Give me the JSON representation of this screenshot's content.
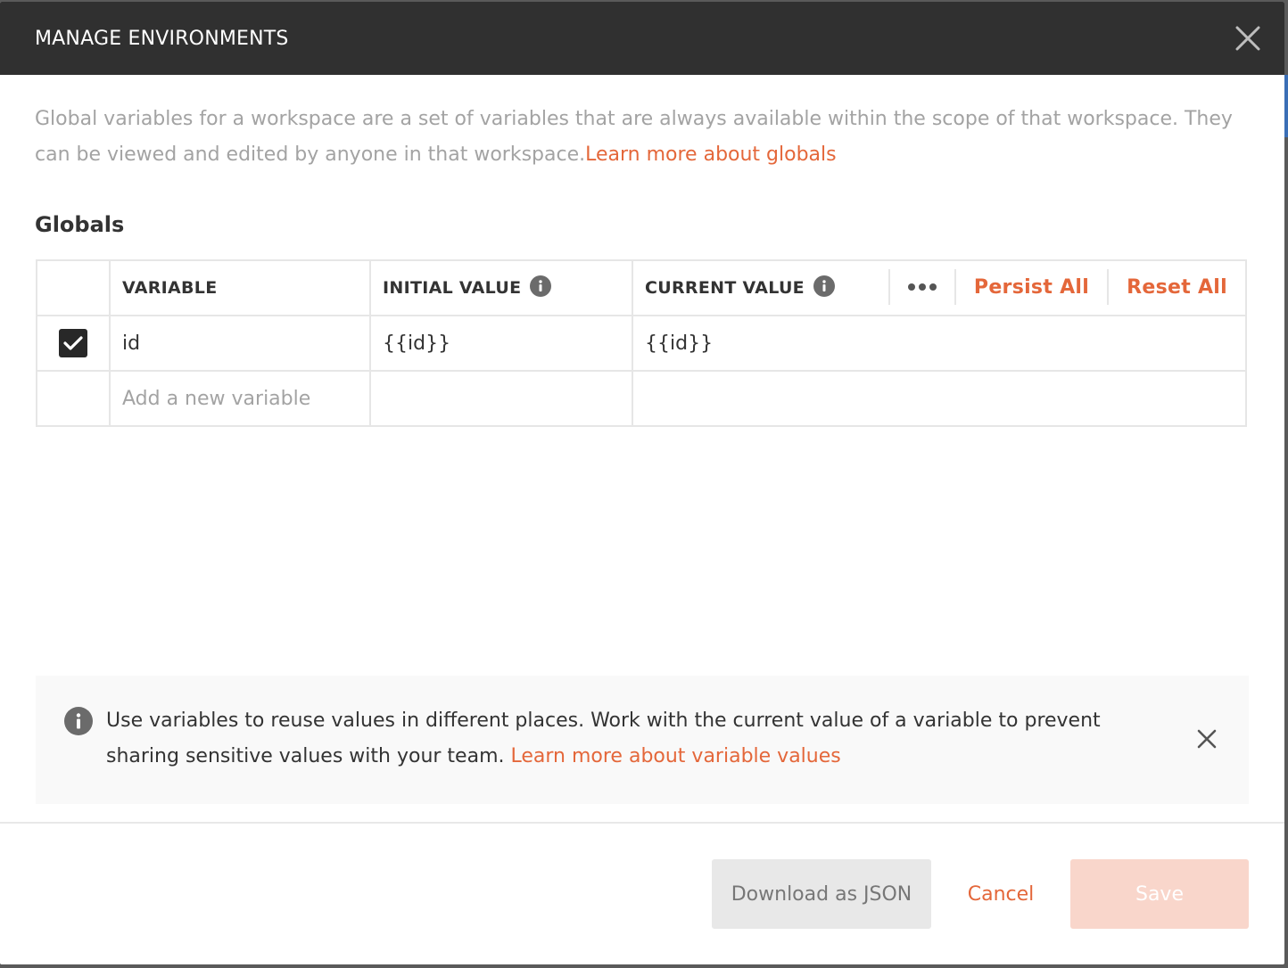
{
  "modal": {
    "title": "MANAGE ENVIRONMENTS"
  },
  "description": {
    "text": "Global variables for a workspace are a set of variables that are always available within the scope of that workspace. They can be viewed and edited by anyone in that workspace.",
    "link": "Learn more about globals"
  },
  "section": {
    "title": "Globals"
  },
  "table": {
    "headers": {
      "variable": "VARIABLE",
      "initial_value": "INITIAL VALUE",
      "current_value": "CURRENT VALUE"
    },
    "actions": {
      "persist_all": "Persist All",
      "reset_all": "Reset All"
    },
    "rows": [
      {
        "checked": true,
        "variable": "id",
        "initial_value": "{{id}}",
        "current_value": "{{id}}"
      }
    ],
    "new_row_placeholder": "Add a new variable"
  },
  "tip": {
    "text": "Use variables to reuse values in different places. Work with the current value of a variable to prevent sharing sensitive values with your team.",
    "link": "Learn more about variable values"
  },
  "footer": {
    "download": "Download as JSON",
    "cancel": "Cancel",
    "save": "Save"
  },
  "colors": {
    "accent": "#e4673a",
    "header_bg": "#303030",
    "save_disabled_bg": "#f9d6cb"
  },
  "icons": [
    "close-icon",
    "info-icon",
    "check-icon",
    "more-horizontal-icon"
  ]
}
